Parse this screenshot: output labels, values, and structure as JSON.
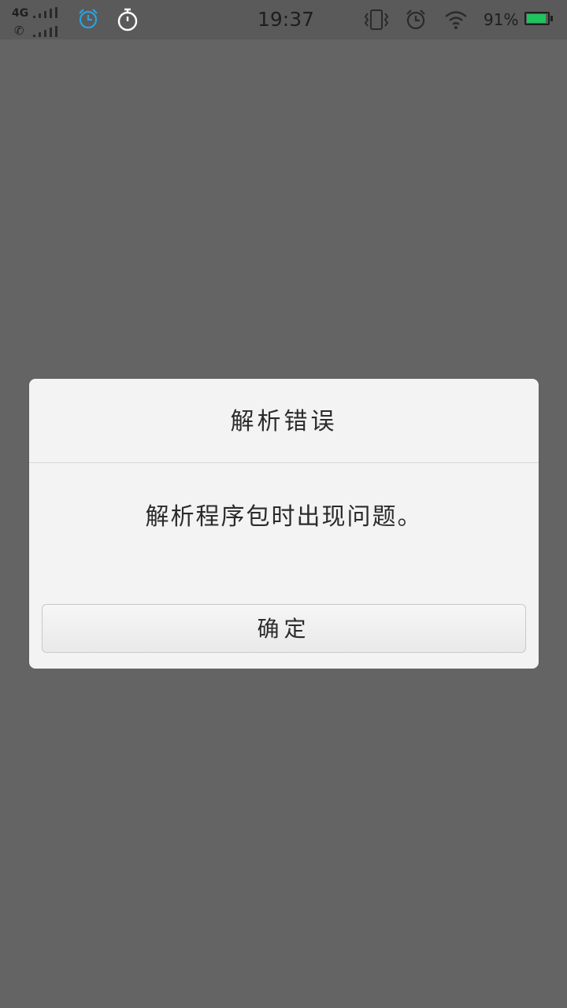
{
  "status_bar": {
    "network": "4G",
    "time": "19:37",
    "battery_percent": "91%",
    "battery_level": 0.91,
    "icons": [
      "signal-icon",
      "call-signal-icon",
      "alarm-icon",
      "stopwatch-icon",
      "vibrate-icon",
      "alarm-clock-icon",
      "wifi-icon",
      "battery-icon"
    ],
    "colors": {
      "alarm": "#29a3dd",
      "battery": "#1fc45c"
    }
  },
  "dialog": {
    "title": "解析错误",
    "message": "解析程序包时出现问题。",
    "ok_label": "确定"
  }
}
